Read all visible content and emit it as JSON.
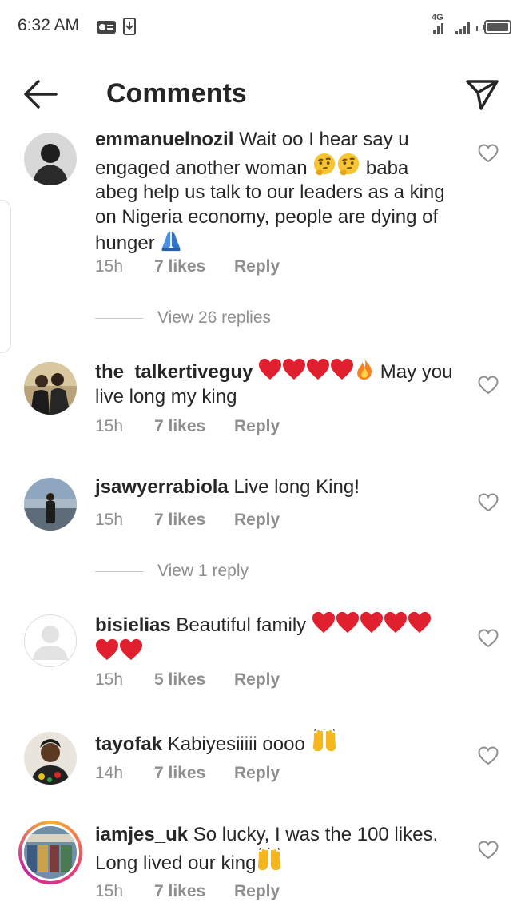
{
  "status_bar": {
    "time": "6:32 AM",
    "network": "4G"
  },
  "header": {
    "title": "Comments"
  },
  "comments": [
    {
      "username": "emmanuelnozil",
      "text_before": "Wait oo I hear say u engaged another woman ",
      "text_after": " baba abeg help us talk to our leaders as a king on Nigeria economy, people are dying of hunger ",
      "time": "15h",
      "likes": "7 likes",
      "reply": "Reply",
      "view_replies": "View 26 replies"
    },
    {
      "username": "the_talkertiveguy",
      "text_after": " May you live long my king",
      "time": "15h",
      "likes": "7 likes",
      "reply": "Reply"
    },
    {
      "username": "jsawyerrabiola",
      "text": "Live long King!",
      "time": "15h",
      "likes": "7 likes",
      "reply": "Reply",
      "view_replies": "View 1 reply"
    },
    {
      "username": "bisielias",
      "text": "Beautiful family ",
      "time": "15h",
      "likes": "5 likes",
      "reply": "Reply"
    },
    {
      "username": "tayofak",
      "text": "Kabiyesiiiii oooo ",
      "time": "14h",
      "likes": "7 likes",
      "reply": "Reply"
    },
    {
      "username": "iamjes_uk",
      "text": "So lucky, I was the 100 likes. Long lived our king",
      "time": "15h",
      "likes": "7 likes",
      "reply": "Reply"
    }
  ],
  "icons": {
    "back": "arrow-left-icon",
    "share": "paper-plane-icon",
    "like": "heart-outline-icon",
    "heart": "red-heart-emoji",
    "fire": "fire-emoji",
    "thinking": "thinking-face-emoji",
    "pray": "folded-hands-emoji",
    "raised_hands": "raising-hands-emoji"
  },
  "colors": {
    "text": "#262626",
    "muted": "#8e8e8e",
    "heart_red": "#e0202e",
    "story_ring": "#ee3e6c"
  }
}
